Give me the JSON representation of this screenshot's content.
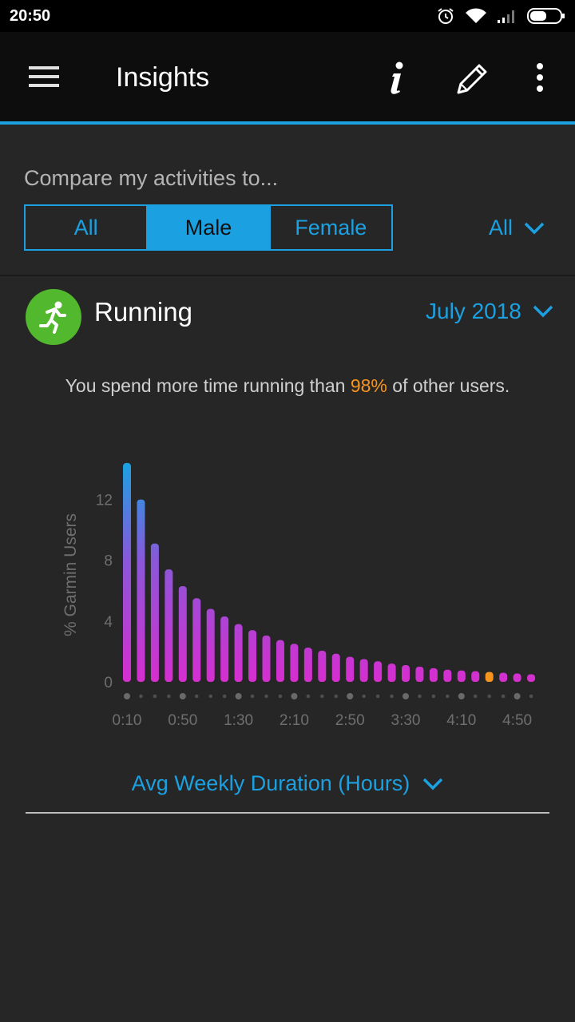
{
  "status": {
    "time": "20:50"
  },
  "header": {
    "title": "Insights"
  },
  "compare": {
    "label": "Compare my activities to...",
    "options": [
      "All",
      "Male",
      "Female"
    ],
    "selected_index": 1,
    "age_filter": "All"
  },
  "activity": {
    "name": "Running",
    "period": "July 2018",
    "insight_prefix": "You spend more time running than ",
    "insight_percent": "98%",
    "insight_suffix": " of other users."
  },
  "metric_selector": "Avg Weekly Duration (Hours)",
  "colors": {
    "accent": "#1ba1e2",
    "highlight": "#f7941d",
    "activity": "#52b82d",
    "bar_top": "#1ba1e2",
    "bar_bottom": "#d62ecf"
  },
  "chart_data": {
    "type": "bar",
    "ylabel": "% Garmin Users",
    "yticks": [
      0,
      4,
      8,
      12
    ],
    "ylim": [
      0,
      14.5
    ],
    "xtick_labels": [
      "0:10",
      "0:50",
      "1:30",
      "2:10",
      "2:50",
      "3:30",
      "4:10",
      "4:50"
    ],
    "xtick_every": 4,
    "values": [
      14.4,
      12.0,
      9.1,
      7.4,
      6.3,
      5.5,
      4.8,
      4.3,
      3.8,
      3.4,
      3.05,
      2.75,
      2.5,
      2.25,
      2.05,
      1.85,
      1.65,
      1.5,
      1.35,
      1.2,
      1.1,
      1.0,
      0.9,
      0.8,
      0.75,
      0.7,
      0.65,
      0.6,
      0.55,
      0.5
    ],
    "highlight_index": 26
  }
}
